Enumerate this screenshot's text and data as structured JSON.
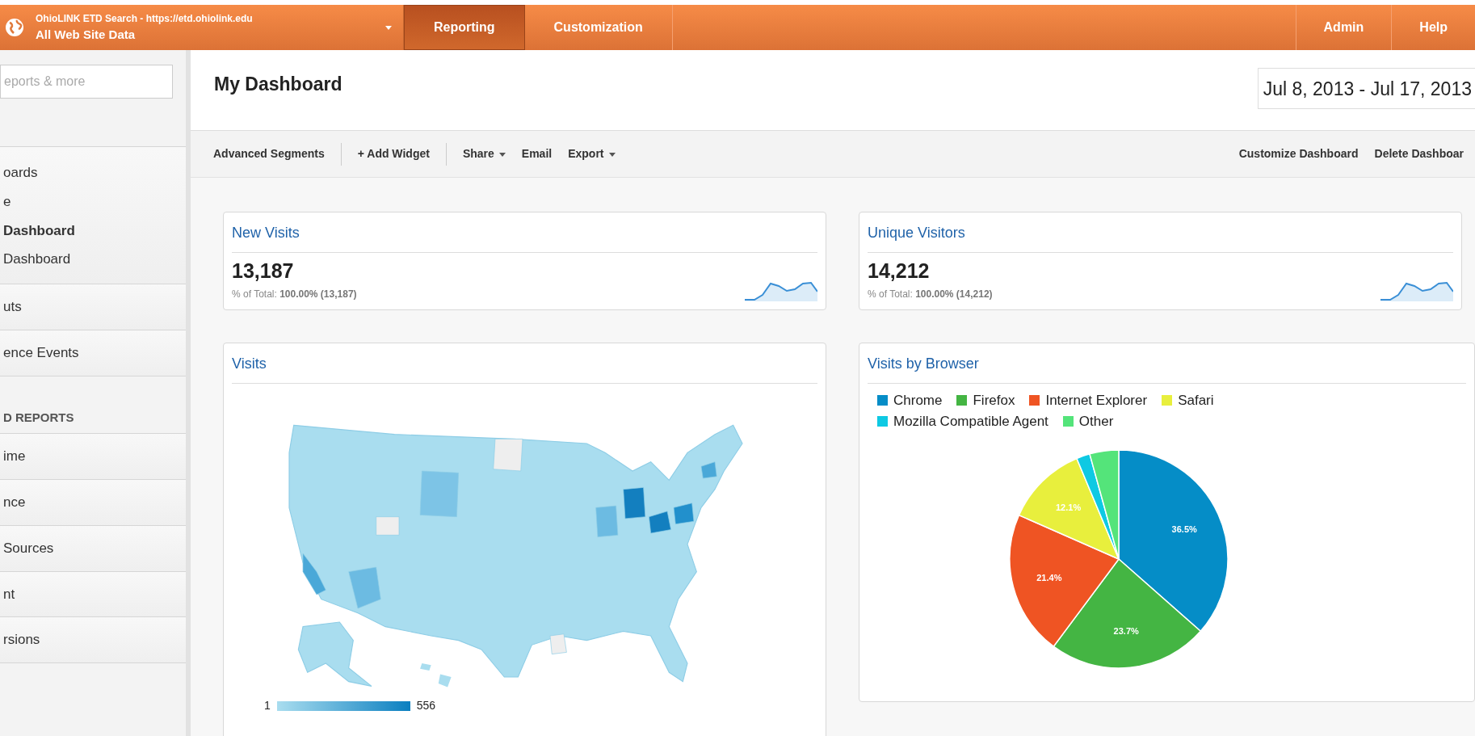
{
  "header": {
    "property": "OhioLINK ETD Search - https://etd.ohiolink.edu",
    "view": "All Web Site Data",
    "tabs": [
      {
        "label": "Reporting",
        "selected": true
      },
      {
        "label": "Customization",
        "selected": false
      }
    ],
    "links": [
      "Admin",
      "Help"
    ]
  },
  "sidebar": {
    "search": {
      "placeholder": "eports & more"
    },
    "sections": [
      {
        "rows": [
          {
            "label": "oards",
            "selected": false
          },
          {
            "label": "e",
            "selected": false
          },
          {
            "label": "Dashboard",
            "selected": true
          },
          {
            "label": "Dashboard",
            "selected": false
          }
        ]
      },
      {
        "rows": [
          {
            "label": "uts",
            "selected": false
          }
        ]
      },
      {
        "rows": [
          {
            "label": "ence Events",
            "selected": false
          }
        ]
      },
      {
        "heading": "D REPORTS"
      },
      {
        "rows": [
          {
            "label": "ime",
            "selected": false
          }
        ]
      },
      {
        "rows": [
          {
            "label": "nce",
            "selected": false
          }
        ]
      },
      {
        "rows": [
          {
            "label": "Sources",
            "selected": false
          }
        ]
      },
      {
        "rows": [
          {
            "label": "nt",
            "selected": false
          }
        ]
      },
      {
        "rows": [
          {
            "label": "rsions",
            "selected": false
          }
        ]
      }
    ]
  },
  "page": {
    "title": "My Dashboard",
    "date_range": "Jul 8, 2013 - Jul 17, 2013"
  },
  "toolbar": {
    "groups": [
      [
        {
          "label": "Advanced Segments",
          "dropdown": false
        }
      ],
      [
        {
          "label": "+ Add Widget",
          "dropdown": false
        }
      ],
      [
        {
          "label": "Share",
          "dropdown": true
        },
        {
          "label": "Email",
          "dropdown": false
        },
        {
          "label": "Export",
          "dropdown": true
        }
      ]
    ],
    "right": [
      "Customize Dashboard",
      "Delete Dashboar"
    ]
  },
  "metrics": [
    {
      "title": "New Visits",
      "value": "13,187",
      "note": "% of Total: **100.00% (13,187)**"
    },
    {
      "title": "Unique Visitors",
      "value": "14,212",
      "note": "% of Total: **100.00% (14,212)**"
    }
  ],
  "map_widget": {
    "title": "Visits",
    "scale_min": "1",
    "scale_max": "556"
  },
  "browser_widget": {
    "title": "Visits by Browser",
    "legend": [
      {
        "color": "#058dc7"
      },
      {
        "color": "#44b543"
      },
      {
        "color": "#ef5423"
      },
      {
        "color": "#e8ef3d"
      },
      {
        "color": "#0ec9e3"
      },
      {
        "color": "#54e47a"
      }
    ],
    "chart_data": {
      "type": "pie",
      "categories": [
        "Chrome",
        "Firefox",
        "Internet Explorer",
        "Safari",
        "Mozilla Compatible Agent",
        "Other"
      ],
      "series": [
        {
          "values": [
            36.5,
            23.7,
            21.4,
            12.1,
            2.0,
            4.3
          ]
        }
      ],
      "value_labels": [
        "36.5%",
        "23.7%",
        "21.4%",
        "12.1%",
        null,
        null
      ]
    }
  }
}
